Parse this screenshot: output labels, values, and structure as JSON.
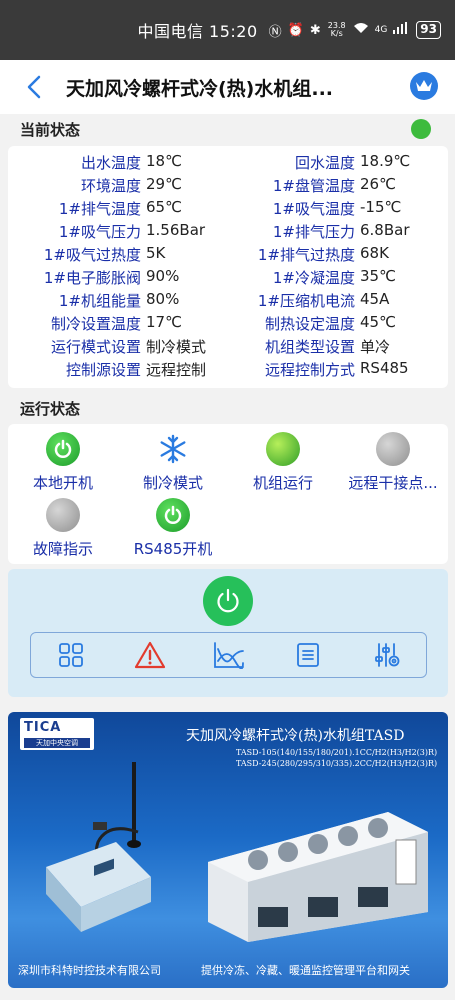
{
  "status_bar": {
    "carrier_time": "中国电信 15:20",
    "net_speed_value": "23.8",
    "net_speed_unit": "K/s",
    "network": "4G",
    "battery": "93"
  },
  "header": {
    "title": "天加风冷螺杆式冷(热)水机组..."
  },
  "current_status": {
    "title": "当前状态",
    "indicator_color": "#3dbb3d",
    "rows": [
      {
        "k1": "出水温度",
        "v1": "18℃",
        "k2": "回水温度",
        "v2": "18.9℃"
      },
      {
        "k1": "环境温度",
        "v1": "29℃",
        "k2": "1#盘管温度",
        "v2": "26℃"
      },
      {
        "k1": "1#排气温度",
        "v1": "65℃",
        "k2": "1#吸气温度",
        "v2": "-15℃"
      },
      {
        "k1": "1#吸气压力",
        "v1": "1.56Bar",
        "k2": "1#排气压力",
        "v2": "6.8Bar"
      },
      {
        "k1": "1#吸气过热度",
        "v1": "5K",
        "k2": "1#排气过热度",
        "v2": "68K"
      },
      {
        "k1": "1#电子膨胀阀",
        "v1": "90%",
        "k2": "1#冷凝温度",
        "v2": "35℃"
      },
      {
        "k1": "1#机组能量",
        "v1": "80%",
        "k2": "1#压缩机电流",
        "v2": "45A"
      },
      {
        "k1": "制冷设置温度",
        "v1": "17℃",
        "k2": "制热设定温度",
        "v2": "45℃"
      },
      {
        "k1": "运行模式设置",
        "v1": "制冷模式",
        "k2": "机组类型设置",
        "v2": "单冷"
      },
      {
        "k1": "控制源设置",
        "v1": "远程控制",
        "k2": "远程控制方式",
        "v2": "RS485"
      }
    ]
  },
  "run_status": {
    "title": "运行状态",
    "items": [
      {
        "label": "本地开机",
        "icon": "power-green-icon"
      },
      {
        "label": "制冷模式",
        "icon": "snowflake-icon"
      },
      {
        "label": "机组运行",
        "icon": "green-ball-icon"
      },
      {
        "label": "远程干接点...",
        "icon": "gray-ball-icon"
      },
      {
        "label": "故障指示",
        "icon": "gray-ball-icon"
      },
      {
        "label": "RS485开机",
        "icon": "power-green-icon"
      }
    ]
  },
  "control": {
    "power_icon": "power-icon",
    "tools": [
      "grid-icon",
      "warning-icon",
      "chart-icon",
      "list-icon",
      "settings-sliders-icon"
    ]
  },
  "banner": {
    "brand": "TICA",
    "brand_sub": "天加中央空调",
    "title": "天加风冷螺杆式冷(热)水机组TASD",
    "model_line1": "TASD-105(140/155/180/201).1CC/H2(H3/H2(3)R)",
    "model_line2": "TASD-245(280/295/310/335).2CC/H2(H3/H2(3)R)",
    "footer_left": "深圳市科特时控技术有限公司",
    "footer_right": "提供冷冻、冷藏、暖通监控管理平台和网关"
  }
}
